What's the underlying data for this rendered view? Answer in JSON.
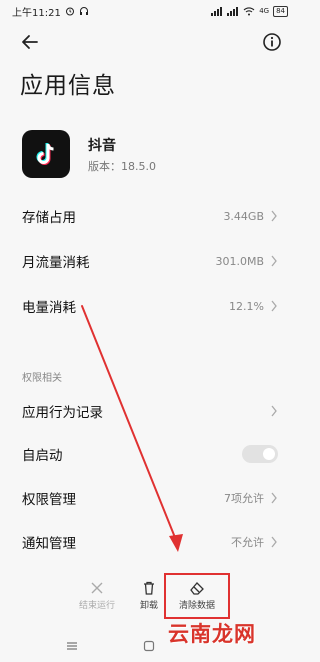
{
  "status_bar": {
    "time": "上午11:21",
    "network": "4G",
    "battery": "84"
  },
  "page_title": "应用信息",
  "app": {
    "name": "抖音",
    "version": "版本：18.5.0"
  },
  "rows": {
    "storage": {
      "label": "存储占用",
      "value": "3.44GB"
    },
    "traffic": {
      "label": "月流量消耗",
      "value": "301.0MB"
    },
    "battery": {
      "label": "电量消耗",
      "value": "12.1%"
    }
  },
  "permissions_section": {
    "title": "权限相关",
    "behavior": {
      "label": "应用行为记录"
    },
    "autostart": {
      "label": "自启动",
      "enabled": false
    },
    "permission_mgmt": {
      "label": "权限管理",
      "value": "7项允许"
    },
    "notification_mgmt": {
      "label": "通知管理",
      "value": "不允许"
    }
  },
  "actions": {
    "force_stop": "结束运行",
    "uninstall": "卸载",
    "clear_data": "清除数据"
  },
  "watermark": "云南龙网",
  "colors": {
    "annotation_red": "#e03131",
    "background": "#f7f7f7"
  }
}
